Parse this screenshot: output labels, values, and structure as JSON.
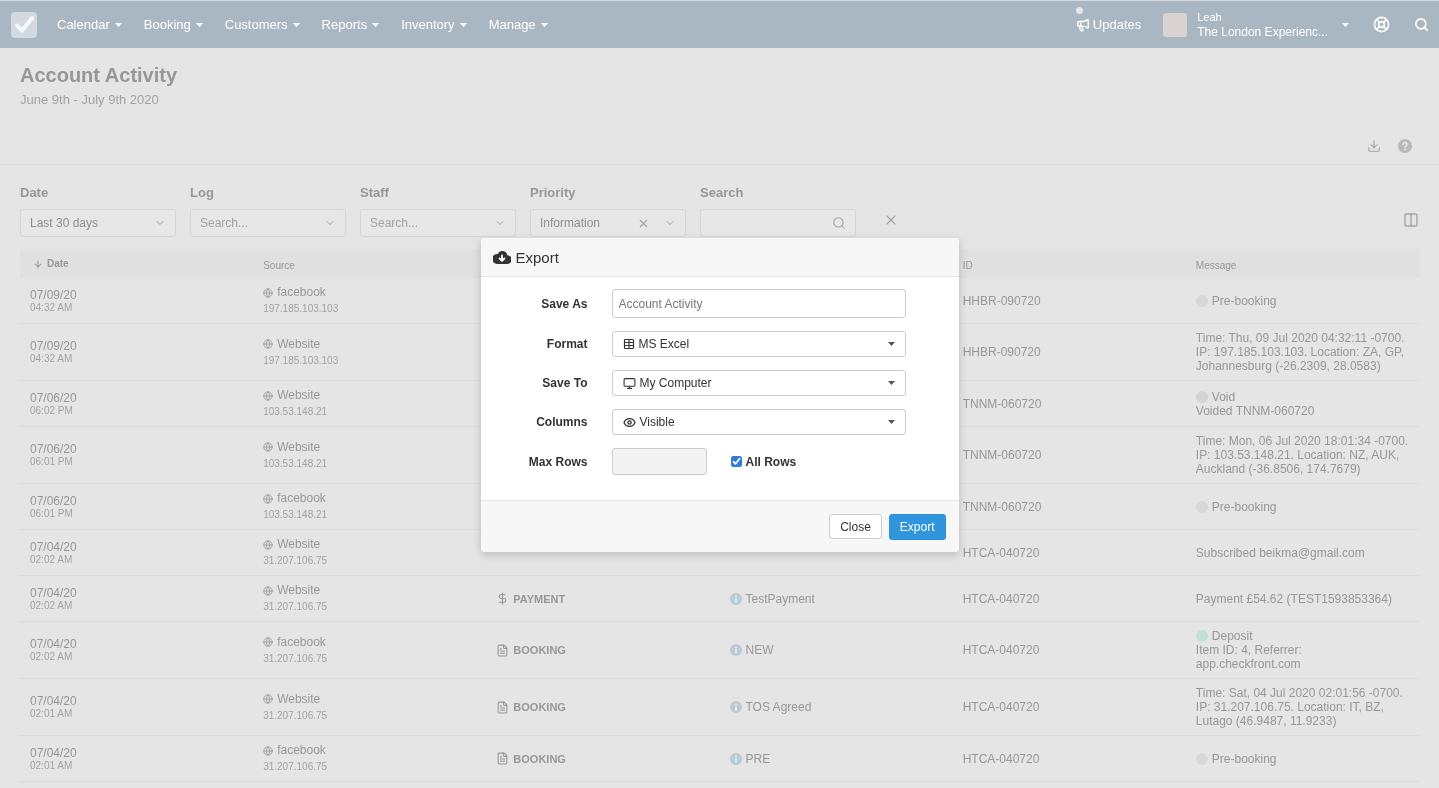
{
  "nav": {
    "items": [
      "Calendar",
      "Booking",
      "Customers",
      "Reports",
      "Inventory",
      "Manage"
    ],
    "updates": "Updates",
    "user": {
      "name": "Leah",
      "account": "The London Experienc..."
    }
  },
  "page": {
    "title": "Account Activity",
    "subtitle": "June 9th - July 9th 2020"
  },
  "filters": [
    {
      "label": "Date",
      "kind": "select",
      "value": "Last 30 days"
    },
    {
      "label": "Log",
      "kind": "select",
      "placeholder": "Search..."
    },
    {
      "label": "Staff",
      "kind": "select",
      "placeholder": "Search..."
    },
    {
      "label": "Priority",
      "kind": "select",
      "value": "Information",
      "clearable": true
    },
    {
      "label": "Search",
      "kind": "search"
    }
  ],
  "table": {
    "columns": {
      "date": {
        "label": "Date",
        "sorted": true
      },
      "source": {
        "label": "Source",
        "sorted": false
      },
      "id": {
        "label": "ID",
        "sorted": false
      },
      "message": {
        "label": "Message",
        "sorted": false
      }
    },
    "rows": [
      {
        "date": "07/09/20",
        "time": "04:32 AM",
        "source": "facebook",
        "ip": "197.185.103.103",
        "id": "HHBR-090720",
        "message": {
          "kind": "status",
          "label": "Pre-booking",
          "color": "#d8d8d8"
        }
      },
      {
        "date": "07/09/20",
        "time": "04:32 AM",
        "source": "Website",
        "ip": "197.185.103.103",
        "id": "HHBR-090720",
        "message": {
          "kind": "text",
          "text": "Time: Thu, 09 Jul 2020 04:32:11 -0700. IP: 197.185.103.103. Location: ZA, GP, Johannesburg (-26.2309, 28.0583)"
        }
      },
      {
        "date": "07/06/20",
        "time": "06:02 PM",
        "source": "Website",
        "ip": "103.53.148.21",
        "id": "TNNM-060720",
        "message": {
          "kind": "status",
          "label": "Void",
          "detail": "Voided TNNM-060720",
          "color": "#d4d4d4"
        }
      },
      {
        "date": "07/06/20",
        "time": "06:01 PM",
        "source": "Website",
        "ip": "103.53.148.21",
        "id": "TNNM-060720",
        "message": {
          "kind": "text",
          "text": "Time: Mon, 06 Jul 2020 18:01:34 -0700. IP: 103.53.148.21. Location: NZ, AUK, Auckland (-36.8506, 174.7679)"
        }
      },
      {
        "date": "07/06/20",
        "time": "06:01 PM",
        "source": "facebook",
        "ip": "103.53.148.21",
        "id": "TNNM-060720",
        "message": {
          "kind": "status",
          "label": "Pre-booking",
          "color": "#d8d8d8"
        }
      },
      {
        "date": "07/04/20",
        "time": "02:02 AM",
        "source": "Website",
        "ip": "31.207.106.75",
        "id": "HTCA-040720",
        "message": {
          "kind": "text",
          "text": "Subscribed beikma@gmail.com"
        }
      },
      {
        "date": "07/04/20",
        "time": "02:02 AM",
        "source": "Website",
        "ip": "31.207.106.75",
        "column_3": {
          "kind": "payment",
          "label": "PAYMENT"
        },
        "column_4": "TestPayment",
        "id": "HTCA-040720",
        "message": {
          "kind": "text",
          "text": "Payment £54.62 (TEST1593853364)"
        }
      },
      {
        "date": "07/04/20",
        "time": "02:02 AM",
        "source": "facebook",
        "ip": "31.207.106.75",
        "column_3": {
          "kind": "booking",
          "label": "BOOKING"
        },
        "column_4": "NEW",
        "id": "HTCA-040720",
        "message": {
          "kind": "status",
          "label": "Deposit",
          "detail": "Item ID: 4, Referrer: app.checkfront.com",
          "color": "#c2e1d4"
        }
      },
      {
        "date": "07/04/20",
        "time": "02:01 AM",
        "source": "Website",
        "ip": "31.207.106.75",
        "column_3": {
          "kind": "booking",
          "label": "BOOKING"
        },
        "column_4": "TOS Agreed",
        "id": "HTCA-040720",
        "message": {
          "kind": "text",
          "text": "Time: Sat, 04 Jul 2020 02:01:56 -0700. IP: 31.207.106.75. Location: IT, BZ, Lutago (46.9487, 11.9233)"
        }
      },
      {
        "date": "07/04/20",
        "time": "02:01 AM",
        "source": "facebook",
        "ip": "31.207.106.75",
        "column_3": {
          "kind": "booking",
          "label": "BOOKING"
        },
        "column_4": "PRE",
        "id": "HTCA-040720",
        "message": {
          "kind": "status",
          "label": "Pre-booking",
          "color": "#d8d8d8"
        }
      }
    ]
  },
  "export_dialog": {
    "title": "Export",
    "save_as": {
      "label": "Save As",
      "placeholder": "Account Activity"
    },
    "format": {
      "label": "Format",
      "value": "MS Excel"
    },
    "save_to": {
      "label": "Save To",
      "value": "My Computer"
    },
    "columns": {
      "label": "Columns",
      "value": "Visible"
    },
    "max_rows": {
      "label": "Max Rows",
      "disabled": true,
      "all_rows": {
        "label": "All Rows",
        "checked": true
      }
    },
    "buttons": [
      {
        "label": "Close",
        "kind": "default"
      },
      {
        "label": "Export",
        "kind": "primary"
      }
    ]
  }
}
